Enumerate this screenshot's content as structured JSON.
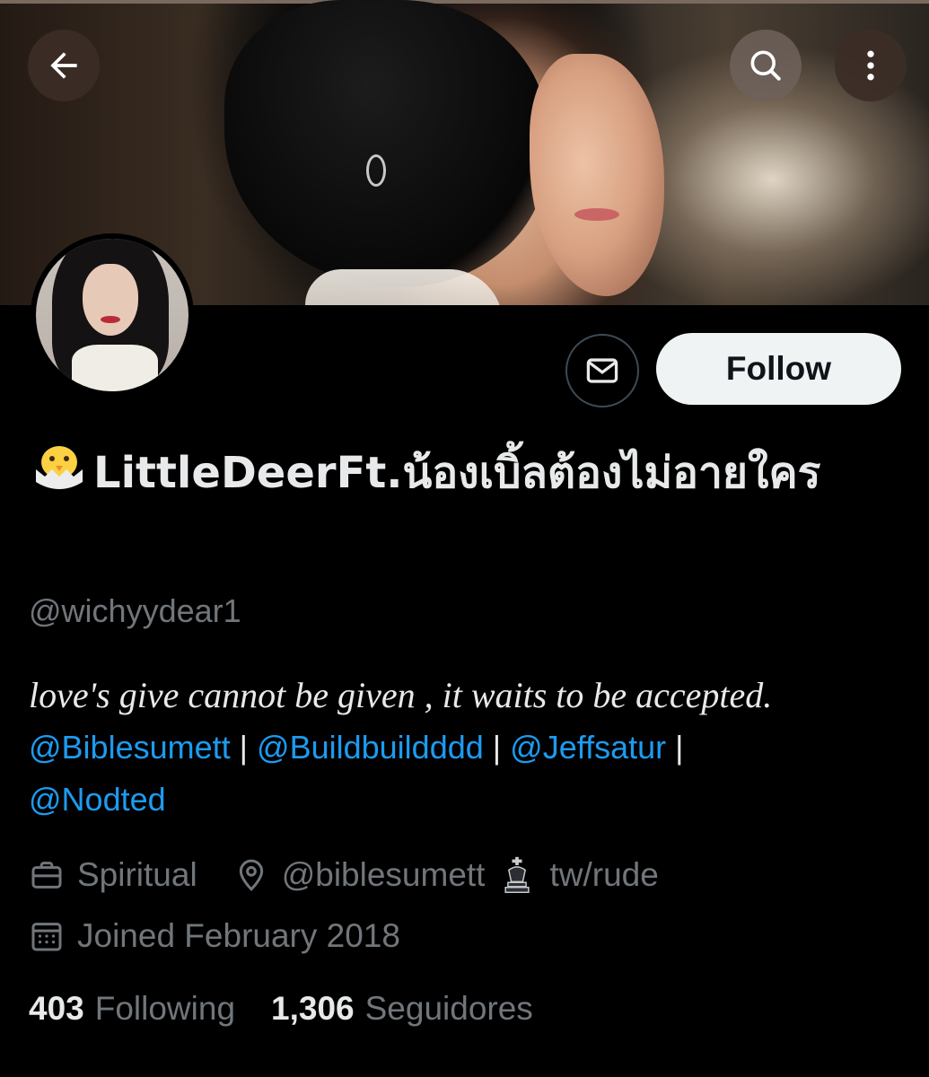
{
  "header": {
    "back_icon": "arrow-left-icon",
    "search_icon": "search-icon",
    "more_icon": "more-vertical-icon"
  },
  "profile": {
    "display_name_emoji": "hatching-chick-emoji",
    "display_name": "LittleDeerFt.น้องเบิ้ลต้องไม่อายใคร",
    "handle": "@wichyydear1",
    "bio_quote": "love's give cannot be given , it waits to be accepted.",
    "bio_mentions": [
      "@Biblesumett",
      "@Buildbuildddd",
      "@Jeffsatur",
      "@Nodted"
    ],
    "bio_separator": "|",
    "category": "Spiritual",
    "location": "@biblesumett",
    "location_suffix": "tw/rude",
    "joined": "Joined February 2018"
  },
  "actions": {
    "message_icon": "envelope-icon",
    "follow_label": "Follow"
  },
  "stats": {
    "following_count": "403",
    "following_label": "Following",
    "followers_count": "1,306",
    "followers_label": "Seguidores"
  },
  "colors": {
    "background": "#000000",
    "primary_text": "#e7e9ea",
    "secondary_text": "#71767b",
    "link": "#1d9bf0",
    "follow_button_bg": "#eff3f4"
  }
}
